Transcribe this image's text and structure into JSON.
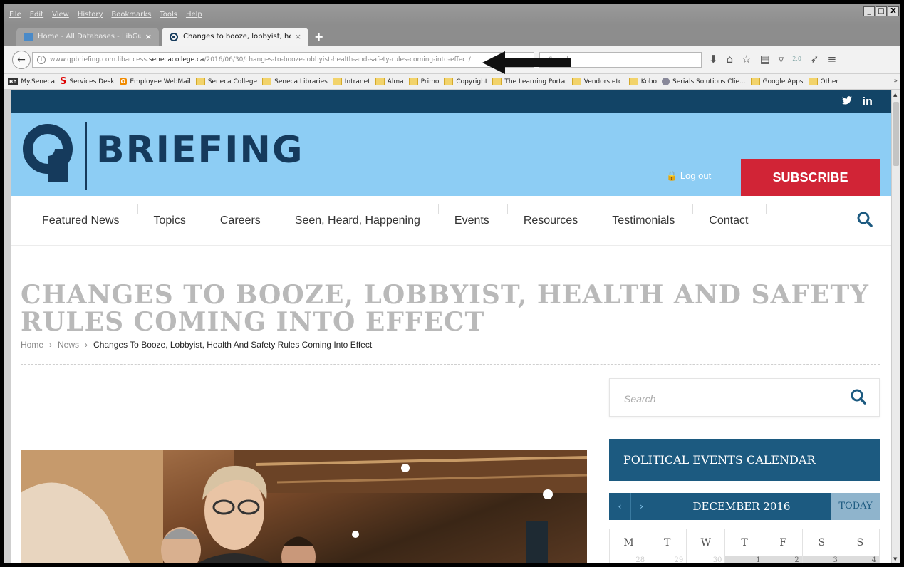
{
  "menubar": {
    "items": [
      "File",
      "Edit",
      "View",
      "History",
      "Bookmarks",
      "Tools",
      "Help"
    ],
    "window_controls": [
      "_",
      "□",
      "X"
    ]
  },
  "tabs": [
    {
      "label": "Home - All Databases - LibGui...",
      "close": "×"
    },
    {
      "label": "Changes to booze, lobbyist, he...",
      "close": "×"
    }
  ],
  "newtab": "+",
  "navbar": {
    "back": "←",
    "info": "i",
    "url_prefix": "www.qpbriefing.com.libaccess.",
    "url_domain": "senecacollege.ca",
    "url_path": "/2016/06/30/changes-to-booze-lobbyist-health-and-safety-rules-coming-into-effect/",
    "search_placeholder": "Search"
  },
  "bookmarks": [
    {
      "icon": "Bb",
      "label": "My.Seneca"
    },
    {
      "icon": "S",
      "label": "Services Desk"
    },
    {
      "icon": "O",
      "label": "Employee WebMail"
    },
    {
      "icon": "folder",
      "label": "Seneca College"
    },
    {
      "icon": "folder",
      "label": "Seneca Libraries"
    },
    {
      "icon": "folder",
      "label": "Intranet"
    },
    {
      "icon": "folder",
      "label": "Alma"
    },
    {
      "icon": "folder",
      "label": "Primo"
    },
    {
      "icon": "folder",
      "label": "Copyright"
    },
    {
      "icon": "folder",
      "label": "The Learning Portal"
    },
    {
      "icon": "folder",
      "label": "Vendors etc."
    },
    {
      "icon": "folder",
      "label": "Kobo"
    },
    {
      "icon": "globe",
      "label": "Serials Solutions Clie..."
    },
    {
      "icon": "folder",
      "label": "Google Apps"
    },
    {
      "icon": "folder",
      "label": "Other"
    }
  ],
  "bookmarks_overflow": "»",
  "site": {
    "social": [
      "𝕏",
      "in"
    ],
    "brand": "BRIEFING",
    "logout": "Log out",
    "subscribe": "SUBSCRIBE",
    "nav": [
      "Featured News",
      "Topics",
      "Careers",
      "Seen, Heard, Happening",
      "Events",
      "Resources",
      "Testimonials",
      "Contact"
    ],
    "title": "CHANGES TO BOOZE, LOBBYIST, HEALTH AND SAFETY RULES COMING INTO EFFECT",
    "breadcrumb": {
      "home": "Home",
      "sep": "›",
      "news": "News",
      "current": "Changes To Booze, Lobbyist, Health And Safety Rules Coming Into Effect"
    },
    "sidebar_search_placeholder": "Search",
    "calendar": {
      "heading": "POLITICAL EVENTS CALENDAR",
      "prev": "‹",
      "next": "›",
      "month": "DECEMBER 2016",
      "today": "TODAY",
      "days": [
        "M",
        "T",
        "W",
        "T",
        "F",
        "S",
        "S"
      ],
      "first_week": [
        "28",
        "29",
        "30",
        "1",
        "2",
        "3",
        "4"
      ]
    }
  },
  "colors": {
    "header_bg": "#8dcdf4",
    "top_strip": "#124466",
    "brand": "#153a5c",
    "subscribe": "#d12436",
    "calendar": "#1c5a80"
  }
}
